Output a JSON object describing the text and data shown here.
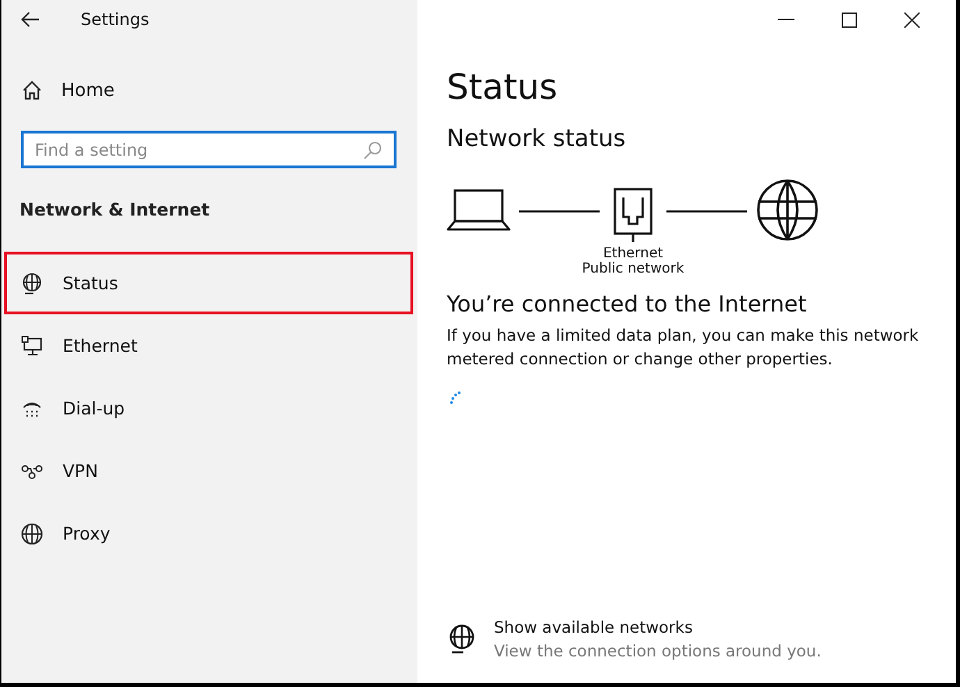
{
  "window": {
    "title": "Settings"
  },
  "sidebar": {
    "home": "Home",
    "search": {
      "placeholder": "Find a setting"
    },
    "section": "Network & Internet",
    "items": [
      {
        "label": "Status",
        "kind": "status",
        "selected": true
      },
      {
        "label": "Ethernet",
        "kind": "ethernet",
        "selected": false
      },
      {
        "label": "Dial-up",
        "kind": "dialup",
        "selected": false
      },
      {
        "label": "VPN",
        "kind": "vpn",
        "selected": false
      },
      {
        "label": "Proxy",
        "kind": "proxy",
        "selected": false
      }
    ]
  },
  "main": {
    "title": "Status",
    "subtitle": "Network status",
    "adapter": "Ethernet",
    "network_type": "Public network",
    "connection_heading": "You’re connected to the Internet",
    "description_lines": [
      "If you have a limited data plan, you can make this network",
      "metered connection or change other properties."
    ],
    "link": {
      "title": "Show available networks",
      "subtitle": "View the connection options around you."
    }
  }
}
